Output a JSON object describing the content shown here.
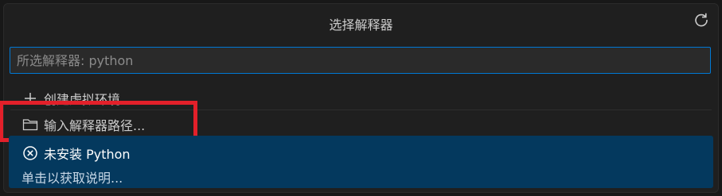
{
  "picker": {
    "title": "选择解释器",
    "refresh_icon": "refresh-icon",
    "search": {
      "value": "",
      "placeholder": "所选解释器: python"
    },
    "items": [
      {
        "icon": "plus-icon",
        "label": "创建虚拟环境..."
      },
      {
        "icon": "folder-icon",
        "label": "输入解释器路径..."
      }
    ],
    "selected_item": {
      "icon": "circle-x-icon",
      "label": "未安装 Python",
      "detail": "单击以获取说明..."
    }
  },
  "colors": {
    "accent_border": "#0078d4",
    "selection_bg": "#04395e",
    "annotation_red": "#e3202a"
  }
}
